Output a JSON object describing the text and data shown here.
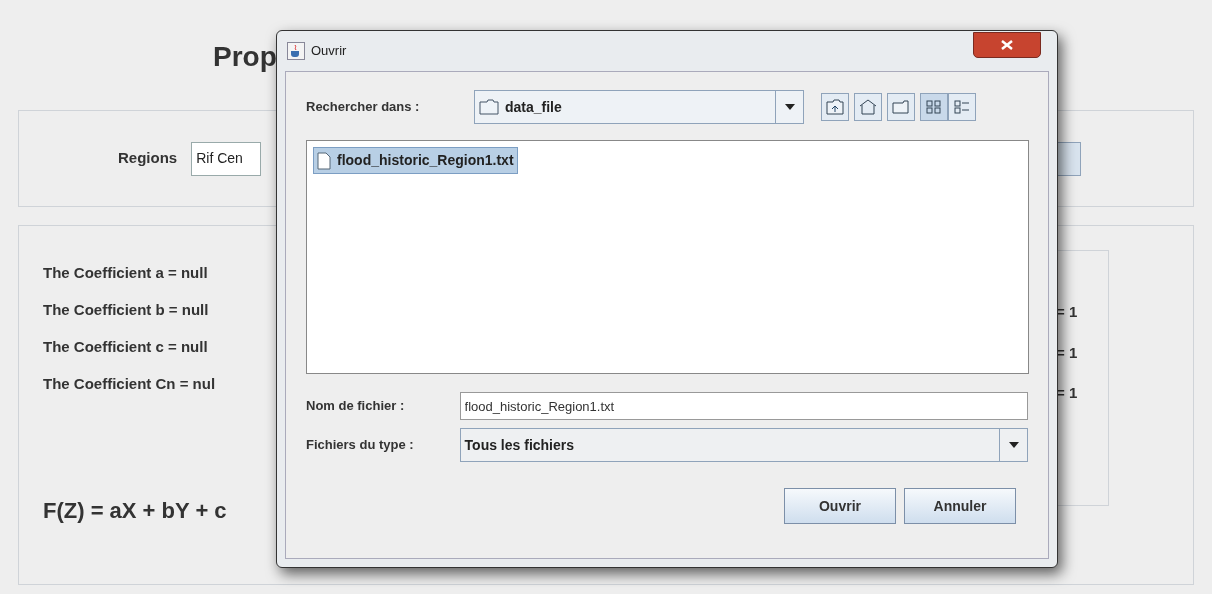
{
  "app": {
    "title_visible": "Prop",
    "regions_label": "Regions",
    "regions_value": "Rif Cen",
    "coefficients": [
      "The Coefficient a = null",
      "The Coefficient b = null",
      "The Coefficient c = null",
      "The Coefficient Cn = nul"
    ],
    "right_values": [
      "= 1",
      "= 1",
      "= 1"
    ],
    "formula": "F(Z) = aX + bY + c"
  },
  "dialog": {
    "title": "Ouvrir",
    "look_in_label": "Rechercher dans :",
    "look_in_value": "data_file",
    "files": [
      {
        "name": "flood_historic_Region1.txt",
        "selected": true
      }
    ],
    "view_modes": [
      {
        "kind": "icons",
        "selected": true
      },
      {
        "kind": "details",
        "selected": false
      }
    ],
    "file_name_label": "Nom de fichier :",
    "file_name_value": "flood_historic_Region1.txt",
    "file_type_label": "Fichiers du type :",
    "file_type_value": "Tous les fichiers",
    "buttons": [
      "Ouvrir",
      "Annuler"
    ]
  }
}
